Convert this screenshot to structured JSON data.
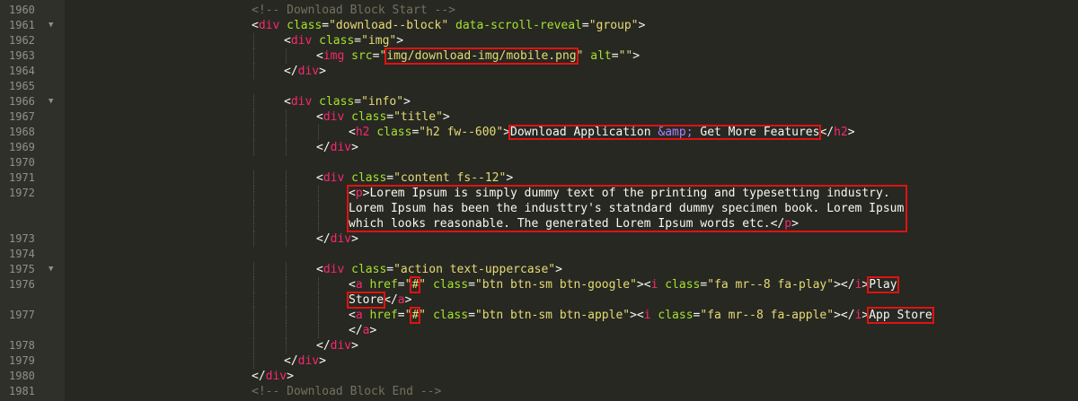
{
  "lines": [
    {
      "num": "1960",
      "fold": false,
      "indent": 0,
      "tokens": [
        {
          "t": "c-com",
          "v": "<!-- Download Block Start -->"
        }
      ]
    },
    {
      "num": "1961",
      "fold": true,
      "indent": 0,
      "tokens": [
        {
          "t": "c-txt",
          "v": "<"
        },
        {
          "t": "c-tag",
          "v": "div"
        },
        {
          "t": "c-txt",
          "v": " "
        },
        {
          "t": "c-attr",
          "v": "class"
        },
        {
          "t": "c-txt",
          "v": "="
        },
        {
          "t": "c-str",
          "v": "\"download--block\""
        },
        {
          "t": "c-txt",
          "v": " "
        },
        {
          "t": "c-attr",
          "v": "data-scroll-reveal"
        },
        {
          "t": "c-txt",
          "v": "="
        },
        {
          "t": "c-str",
          "v": "\"group\""
        },
        {
          "t": "c-txt",
          "v": ">"
        }
      ]
    },
    {
      "num": "1962",
      "fold": false,
      "indent": 1,
      "tokens": [
        {
          "t": "c-txt",
          "v": "<"
        },
        {
          "t": "c-tag",
          "v": "div"
        },
        {
          "t": "c-txt",
          "v": " "
        },
        {
          "t": "c-attr",
          "v": "class"
        },
        {
          "t": "c-txt",
          "v": "="
        },
        {
          "t": "c-str",
          "v": "\"img\""
        },
        {
          "t": "c-txt",
          "v": ">"
        }
      ]
    },
    {
      "num": "1963",
      "fold": false,
      "indent": 2,
      "tokens": [
        {
          "t": "c-txt",
          "v": "<"
        },
        {
          "t": "c-tag",
          "v": "img"
        },
        {
          "t": "c-txt",
          "v": " "
        },
        {
          "t": "c-attr",
          "v": "src"
        },
        {
          "t": "c-txt",
          "v": "="
        },
        {
          "t": "c-str",
          "v": "\""
        },
        {
          "t": "c-str",
          "v": "img/download-img/mobile.png",
          "hl": true
        },
        {
          "t": "c-str",
          "v": "\""
        },
        {
          "t": "c-txt",
          "v": " "
        },
        {
          "t": "c-attr",
          "v": "alt"
        },
        {
          "t": "c-txt",
          "v": "="
        },
        {
          "t": "c-str",
          "v": "\"\""
        },
        {
          "t": "c-txt",
          "v": ">"
        }
      ]
    },
    {
      "num": "1964",
      "fold": false,
      "indent": 1,
      "tokens": [
        {
          "t": "c-txt",
          "v": "</"
        },
        {
          "t": "c-tag",
          "v": "div"
        },
        {
          "t": "c-txt",
          "v": ">"
        }
      ]
    },
    {
      "num": "1965",
      "fold": false,
      "indent": 0,
      "tokens": []
    },
    {
      "num": "1966",
      "fold": true,
      "indent": 1,
      "tokens": [
        {
          "t": "c-txt",
          "v": "<"
        },
        {
          "t": "c-tag",
          "v": "div"
        },
        {
          "t": "c-txt",
          "v": " "
        },
        {
          "t": "c-attr",
          "v": "class"
        },
        {
          "t": "c-txt",
          "v": "="
        },
        {
          "t": "c-str",
          "v": "\"info\""
        },
        {
          "t": "c-txt",
          "v": ">"
        }
      ]
    },
    {
      "num": "1967",
      "fold": false,
      "indent": 2,
      "tokens": [
        {
          "t": "c-txt",
          "v": "<"
        },
        {
          "t": "c-tag",
          "v": "div"
        },
        {
          "t": "c-txt",
          "v": " "
        },
        {
          "t": "c-attr",
          "v": "class"
        },
        {
          "t": "c-txt",
          "v": "="
        },
        {
          "t": "c-str",
          "v": "\"title\""
        },
        {
          "t": "c-txt",
          "v": ">"
        }
      ]
    },
    {
      "num": "1968",
      "fold": false,
      "indent": 3,
      "tokens": [
        {
          "t": "c-txt",
          "v": "<"
        },
        {
          "t": "c-tag",
          "v": "h2"
        },
        {
          "t": "c-txt",
          "v": " "
        },
        {
          "t": "c-attr",
          "v": "class"
        },
        {
          "t": "c-txt",
          "v": "="
        },
        {
          "t": "c-str",
          "v": "\"h2 fw--600\""
        },
        {
          "t": "c-txt",
          "v": ">"
        },
        {
          "t": "c-txt",
          "v": "Download Application ",
          "hlstart": true
        },
        {
          "t": "c-ent",
          "v": "&amp;"
        },
        {
          "t": "c-txt",
          "v": " Get More Features",
          "hlend": true
        },
        {
          "t": "c-txt",
          "v": "</"
        },
        {
          "t": "c-tag",
          "v": "h2"
        },
        {
          "t": "c-txt",
          "v": ">"
        }
      ]
    },
    {
      "num": "1969",
      "fold": false,
      "indent": 2,
      "tokens": [
        {
          "t": "c-txt",
          "v": "</"
        },
        {
          "t": "c-tag",
          "v": "div"
        },
        {
          "t": "c-txt",
          "v": ">"
        }
      ]
    },
    {
      "num": "1970",
      "fold": false,
      "indent": 0,
      "tokens": []
    },
    {
      "num": "1971",
      "fold": false,
      "indent": 2,
      "tokens": [
        {
          "t": "c-txt",
          "v": "<"
        },
        {
          "t": "c-tag",
          "v": "div"
        },
        {
          "t": "c-txt",
          "v": " "
        },
        {
          "t": "c-attr",
          "v": "class"
        },
        {
          "t": "c-txt",
          "v": "="
        },
        {
          "t": "c-str",
          "v": "\"content fs--12\""
        },
        {
          "t": "c-txt",
          "v": ">"
        }
      ]
    },
    {
      "num": "1972",
      "fold": false,
      "indent": 3,
      "tokens": [
        {
          "t": "c-txt",
          "v": "<"
        },
        {
          "t": "c-tag",
          "v": "p"
        },
        {
          "t": "c-txt",
          "v": ">Lorem Ipsum is simply dummy text of the printing and typesetting industry."
        }
      ]
    },
    {
      "num": "",
      "fold": false,
      "indent": 3,
      "tokens": [
        {
          "t": "c-txt",
          "v": "Lorem Ipsum has been the industtry's statndard dummy specimen book. Lorem Ipsum"
        }
      ]
    },
    {
      "num": "",
      "fold": false,
      "indent": 3,
      "tokens": [
        {
          "t": "c-txt",
          "v": "which looks reasonable. The generated Lorem Ipsum words etc.</"
        },
        {
          "t": "c-tag",
          "v": "p"
        },
        {
          "t": "c-txt",
          "v": ">"
        }
      ]
    },
    {
      "num": "1973",
      "fold": false,
      "indent": 2,
      "tokens": [
        {
          "t": "c-txt",
          "v": "</"
        },
        {
          "t": "c-tag",
          "v": "div"
        },
        {
          "t": "c-txt",
          "v": ">"
        }
      ]
    },
    {
      "num": "1974",
      "fold": false,
      "indent": 0,
      "tokens": []
    },
    {
      "num": "1975",
      "fold": true,
      "indent": 2,
      "tokens": [
        {
          "t": "c-txt",
          "v": "<"
        },
        {
          "t": "c-tag",
          "v": "div"
        },
        {
          "t": "c-txt",
          "v": " "
        },
        {
          "t": "c-attr",
          "v": "class"
        },
        {
          "t": "c-txt",
          "v": "="
        },
        {
          "t": "c-str",
          "v": "\"action text-uppercase\""
        },
        {
          "t": "c-txt",
          "v": ">"
        }
      ]
    },
    {
      "num": "1976",
      "fold": false,
      "indent": 3,
      "tokens": [
        {
          "t": "c-txt",
          "v": "<"
        },
        {
          "t": "c-tag",
          "v": "a"
        },
        {
          "t": "c-txt",
          "v": " "
        },
        {
          "t": "c-attr",
          "v": "href"
        },
        {
          "t": "c-txt",
          "v": "="
        },
        {
          "t": "c-str",
          "v": "\""
        },
        {
          "t": "c-str",
          "v": "#",
          "hl": true
        },
        {
          "t": "c-str",
          "v": "\""
        },
        {
          "t": "c-txt",
          "v": " "
        },
        {
          "t": "c-attr",
          "v": "class"
        },
        {
          "t": "c-txt",
          "v": "="
        },
        {
          "t": "c-str",
          "v": "\"btn btn-sm btn-google\""
        },
        {
          "t": "c-txt",
          "v": "><"
        },
        {
          "t": "c-tag",
          "v": "i"
        },
        {
          "t": "c-txt",
          "v": " "
        },
        {
          "t": "c-attr",
          "v": "class"
        },
        {
          "t": "c-txt",
          "v": "="
        },
        {
          "t": "c-str",
          "v": "\"fa mr--8 fa-play\""
        },
        {
          "t": "c-txt",
          "v": "></"
        },
        {
          "t": "c-tag",
          "v": "i"
        },
        {
          "t": "c-txt",
          "v": ">"
        },
        {
          "t": "c-txt",
          "v": "Play",
          "hl": true
        }
      ]
    },
    {
      "num": "",
      "fold": false,
      "indent": 3,
      "tokens": [
        {
          "t": "c-txt",
          "v": "Store",
          "hl": true
        },
        {
          "t": "c-txt",
          "v": "</"
        },
        {
          "t": "c-tag",
          "v": "a"
        },
        {
          "t": "c-txt",
          "v": ">"
        }
      ]
    },
    {
      "num": "1977",
      "fold": false,
      "indent": 3,
      "tokens": [
        {
          "t": "c-txt",
          "v": "<"
        },
        {
          "t": "c-tag",
          "v": "a"
        },
        {
          "t": "c-txt",
          "v": " "
        },
        {
          "t": "c-attr",
          "v": "href"
        },
        {
          "t": "c-txt",
          "v": "="
        },
        {
          "t": "c-str",
          "v": "\""
        },
        {
          "t": "c-str",
          "v": "#",
          "hl": true
        },
        {
          "t": "c-str",
          "v": "\""
        },
        {
          "t": "c-txt",
          "v": " "
        },
        {
          "t": "c-attr",
          "v": "class"
        },
        {
          "t": "c-txt",
          "v": "="
        },
        {
          "t": "c-str",
          "v": "\"btn btn-sm btn-apple\""
        },
        {
          "t": "c-txt",
          "v": "><"
        },
        {
          "t": "c-tag",
          "v": "i"
        },
        {
          "t": "c-txt",
          "v": " "
        },
        {
          "t": "c-attr",
          "v": "class"
        },
        {
          "t": "c-txt",
          "v": "="
        },
        {
          "t": "c-str",
          "v": "\"fa mr--8 fa-apple\""
        },
        {
          "t": "c-txt",
          "v": "></"
        },
        {
          "t": "c-tag",
          "v": "i"
        },
        {
          "t": "c-txt",
          "v": ">"
        },
        {
          "t": "c-txt",
          "v": "App Store",
          "hl": true
        }
      ]
    },
    {
      "num": "",
      "fold": false,
      "indent": 3,
      "tokens": [
        {
          "t": "c-txt",
          "v": "</"
        },
        {
          "t": "c-tag",
          "v": "a"
        },
        {
          "t": "c-txt",
          "v": ">"
        }
      ]
    },
    {
      "num": "1978",
      "fold": false,
      "indent": 2,
      "tokens": [
        {
          "t": "c-txt",
          "v": "</"
        },
        {
          "t": "c-tag",
          "v": "div"
        },
        {
          "t": "c-txt",
          "v": ">"
        }
      ]
    },
    {
      "num": "1979",
      "fold": false,
      "indent": 1,
      "tokens": [
        {
          "t": "c-txt",
          "v": "</"
        },
        {
          "t": "c-tag",
          "v": "div"
        },
        {
          "t": "c-txt",
          "v": ">"
        }
      ]
    },
    {
      "num": "1980",
      "fold": false,
      "indent": 0,
      "tokens": [
        {
          "t": "c-txt",
          "v": "</"
        },
        {
          "t": "c-tag",
          "v": "div"
        },
        {
          "t": "c-txt",
          "v": ">"
        }
      ]
    },
    {
      "num": "1981",
      "fold": false,
      "indent": 0,
      "tokens": [
        {
          "t": "c-com",
          "v": "<!-- Download Block End -->"
        }
      ]
    }
  ]
}
